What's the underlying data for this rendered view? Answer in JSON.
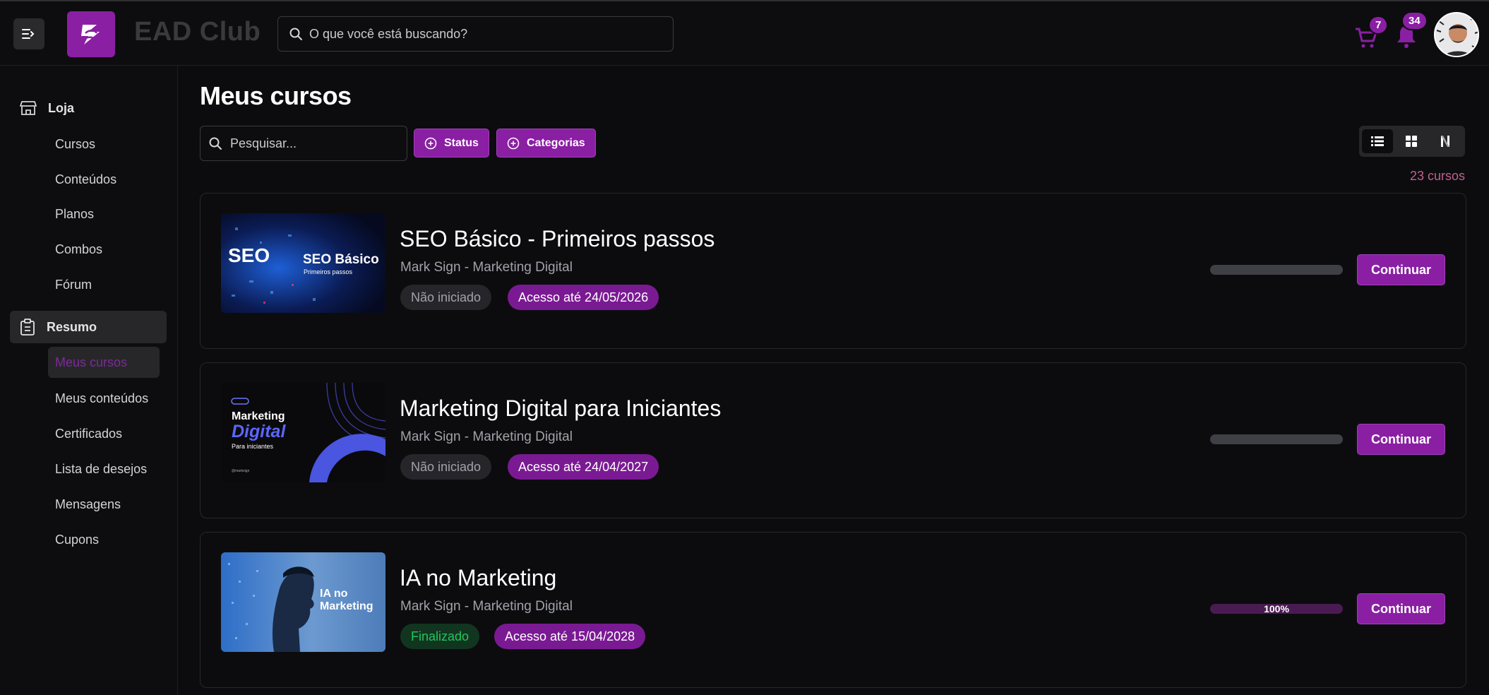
{
  "header": {
    "brand": "EAD Club",
    "search_placeholder": "O que você está buscando?",
    "cart_count": "7",
    "notifications_count": "34"
  },
  "sidebar": {
    "store": {
      "label": "Loja",
      "items": [
        "Cursos",
        "Conteúdos",
        "Planos",
        "Combos",
        "Fórum"
      ]
    },
    "summary": {
      "label": "Resumo",
      "items": [
        "Meus cursos",
        "Meus conteúdos",
        "Certificados",
        "Lista de desejos",
        "Mensagens",
        "Cupons"
      ]
    }
  },
  "main": {
    "title": "Meus cursos",
    "search_placeholder": "Pesquisar...",
    "status_label": "Status",
    "categories_label": "Categorias",
    "count_label": "23 cursos",
    "courses": [
      {
        "title": "SEO Básico - Primeiros passos",
        "subtitle": "Mark Sign - Marketing Digital",
        "status": "Não iniciado",
        "access": "Acesso até 24/05/2026",
        "progress": 0,
        "progress_label": "",
        "button": "Continuar",
        "thumb_line1": "SEO Básico",
        "thumb_line2": "Primeiros passos",
        "thumb_word": "SEO"
      },
      {
        "title": "Marketing Digital para Iniciantes",
        "subtitle": "Mark Sign - Marketing Digital",
        "status": "Não iniciado",
        "access": "Acesso até 24/04/2027",
        "progress": 0,
        "progress_label": "",
        "button": "Continuar",
        "thumb_line1": "Marketing",
        "thumb_line2": "Digital",
        "thumb_line3": "Para iniciantes",
        "thumb_handle": "@marksign"
      },
      {
        "title": "IA no Marketing",
        "subtitle": "Mark Sign - Marketing Digital",
        "status": "Finalizado",
        "access": "Acesso até 15/04/2028",
        "progress": 100,
        "progress_label": "100%",
        "button": "Continuar",
        "thumb_line1": "IA no",
        "thumb_line2": "Marketing"
      }
    ]
  }
}
